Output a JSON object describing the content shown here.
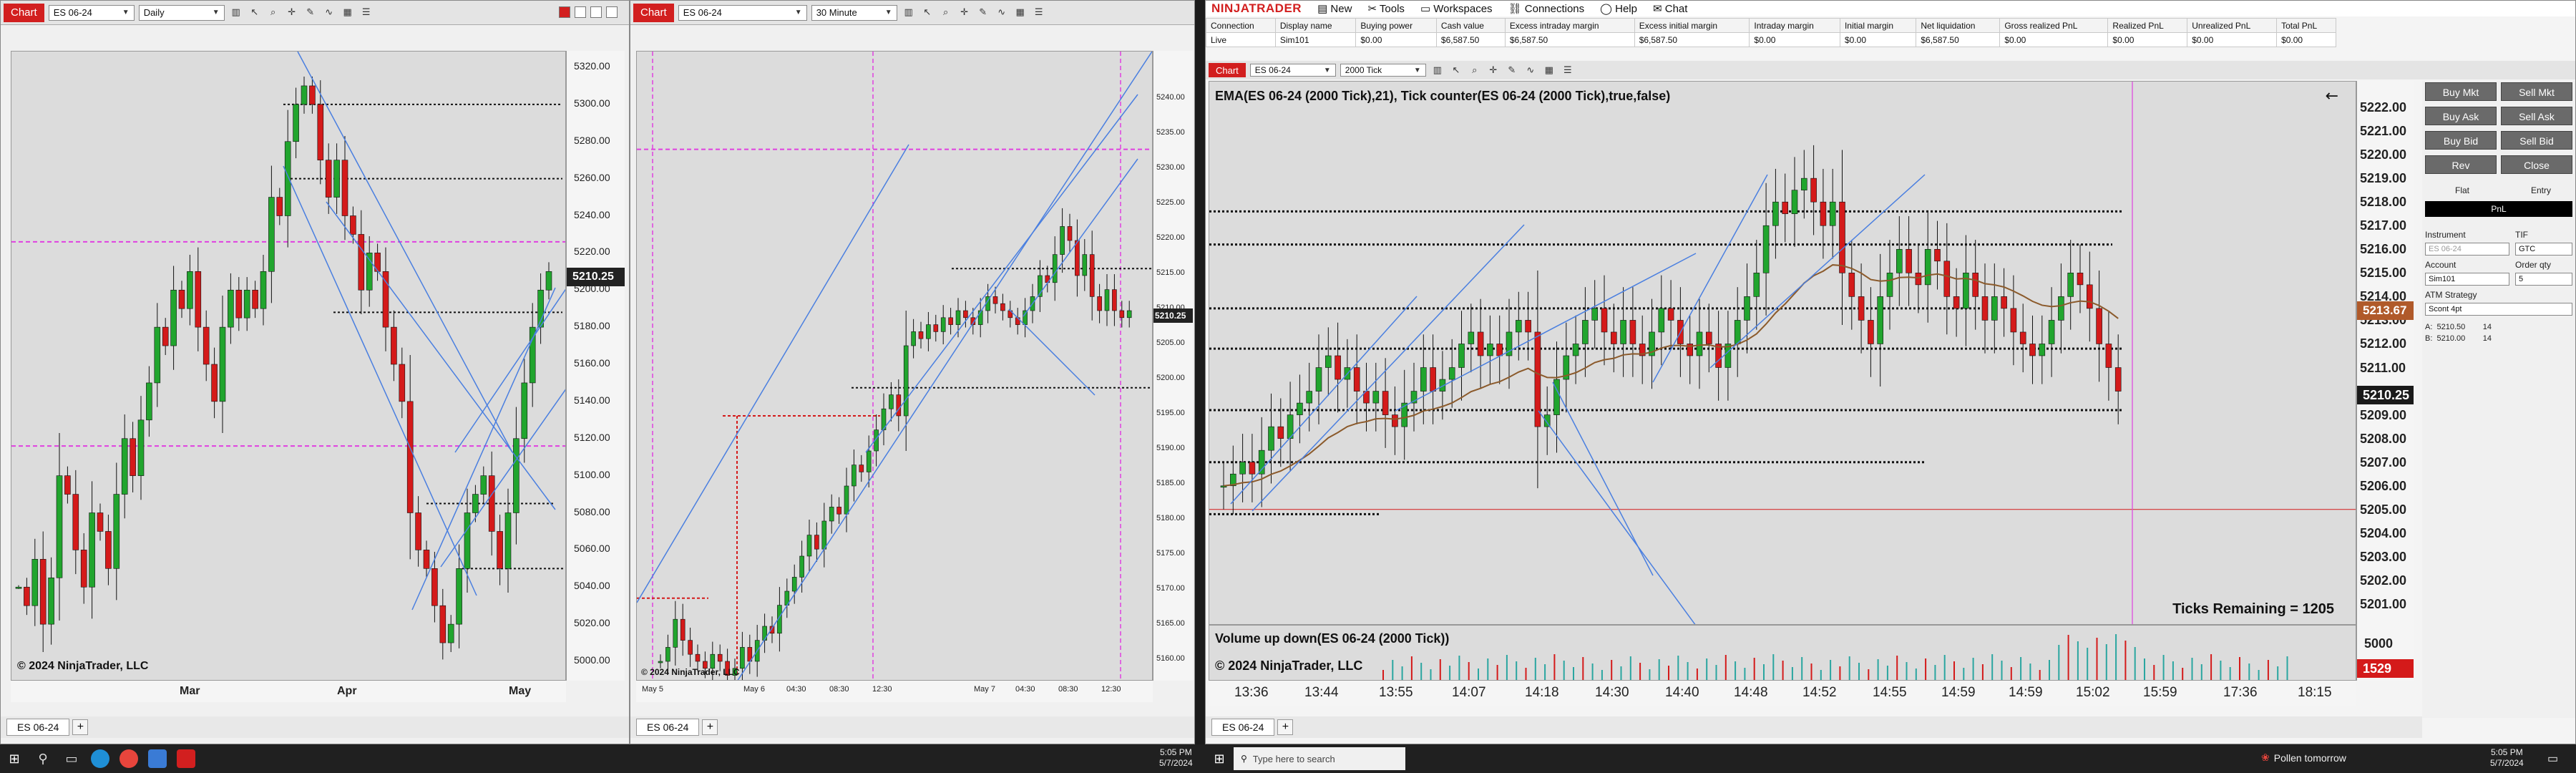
{
  "left_chart": {
    "tab_label": "Chart",
    "instrument": "ES 06-24",
    "interval": "Daily",
    "last_price": "5210.25",
    "y_ticks": [
      "5320.00",
      "5300.00",
      "5280.00",
      "5260.00",
      "5240.00",
      "5220.00",
      "5200.00",
      "5180.00",
      "5160.00",
      "5140.00",
      "5120.00",
      "5100.00",
      "5080.00",
      "5060.00",
      "5040.00",
      "5020.00",
      "5000.00"
    ],
    "x_ticks": [
      "Mar",
      "Apr",
      "May"
    ],
    "copyright": "© 2024 NinjaTrader, LLC",
    "bottom_tab": "ES 06-24"
  },
  "mid_chart": {
    "tab_label": "Chart",
    "instrument": "ES 06-24",
    "interval": "30 Minute",
    "last_price": "5210.25",
    "y_ticks": [
      "5240.00",
      "5235.00",
      "5230.00",
      "5225.00",
      "5220.00",
      "5215.00",
      "5210.00",
      "5205.00",
      "5200.00",
      "5195.00",
      "5190.00",
      "5185.00",
      "5180.00",
      "5175.00",
      "5170.00",
      "5165.00",
      "5160.00"
    ],
    "x_ticks": [
      "May 5",
      "May 6",
      "04:30",
      "08:30",
      "12:30",
      "May 7",
      "04:30",
      "08:30",
      "12:30"
    ],
    "copyright": "© 2024 NinjaTrader, LLC",
    "bottom_tab": "ES 06-24"
  },
  "ninjatrader": {
    "logo": "NINJATRADER",
    "menu": [
      "New",
      "Tools",
      "Workspaces",
      "Connections",
      "Help",
      "Chat"
    ],
    "account_columns": [
      "Connection",
      "Display name",
      "Buying power",
      "Cash value",
      "Excess intraday margin",
      "Excess initial margin",
      "Intraday margin",
      "Initial margin",
      "Net liquidation",
      "Gross realized PnL",
      "Realized PnL",
      "Unrealized PnL",
      "Total PnL"
    ],
    "account_row": [
      "Live",
      "Sim101",
      "$0.00",
      "$6,587.50",
      "$6,587.50",
      "$6,587.50",
      "$0.00",
      "$0.00",
      "$6,587.50",
      "$0.00",
      "$0.00",
      "$0.00",
      "$0.00"
    ]
  },
  "tick_chart": {
    "tab_label": "Chart",
    "instrument": "ES 06-24",
    "interval": "2000 Tick",
    "indicator_title": "EMA(ES 06-24 (2000 Tick),21), Tick counter(ES 06-24 (2000 Tick),true,false)",
    "ticks_remaining": "Ticks Remaining = 1205",
    "volume_title": "Volume up down(ES 06-24 (2000 Tick))",
    "copyright": "© 2024 NinjaTrader, LLC",
    "y_ticks": [
      "5222.00",
      "5221.00",
      "5220.00",
      "5219.00",
      "5218.00",
      "5217.00",
      "5216.00",
      "5215.00",
      "5214.00",
      "5213.00",
      "5212.00",
      "5211.00",
      "5210.00",
      "5209.00",
      "5208.00",
      "5207.00",
      "5206.00",
      "5205.00",
      "5204.00",
      "5203.00",
      "5202.00",
      "5201.00"
    ],
    "ema_price": "5213.67",
    "last_price": "5210.25",
    "volume_axis": "5000",
    "volume_last": "1529",
    "x_ticks": [
      "13:36",
      "13:44",
      "13:55",
      "14:07",
      "14:18",
      "14:30",
      "14:40",
      "14:48",
      "14:52",
      "14:55",
      "14:59",
      "14:59",
      "15:02",
      "15:59",
      "17:36",
      "18:15"
    ],
    "bottom_tab": "ES 06-24"
  },
  "chart_trader": {
    "buttons": [
      "Buy Mkt",
      "Sell Mkt",
      "Buy Ask",
      "Sell Ask",
      "Buy Bid",
      "Sell Bid",
      "Rev",
      "Close"
    ],
    "position": "Flat",
    "entry": "Entry",
    "pnl": "PnL",
    "instrument_label": "Instrument",
    "instrument_value": "ES 06-24",
    "tif_label": "TIF",
    "tif_value": "GTC",
    "account_label": "Account",
    "account_value": "Sim101",
    "order_qty_label": "Order qty",
    "order_qty_value": "5",
    "atm_label": "ATM Strategy",
    "atm_value": "Scont 4pt",
    "ask_line": "A:  5210.50        14",
    "bid_line": "B:  5210.00        14"
  },
  "taskbar": {
    "search_placeholder": "Type here to search",
    "left_clock_time": "5:05 PM",
    "left_clock_date": "5/7/2024",
    "weather": "Pollen tomorrow",
    "right_clock_time": "5:05 PM",
    "right_clock_date": "5/7/2024"
  },
  "colors": {
    "brand": "#d21f1f",
    "candle_up": "#21a52e",
    "candle_down": "#d41a1a",
    "trend_line": "#4a7fe0",
    "magenta_line": "#e040e0",
    "ema": "#8b5a2b"
  }
}
